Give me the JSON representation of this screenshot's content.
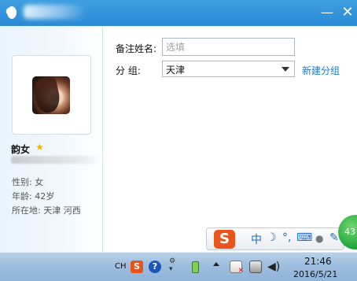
{
  "window": {
    "title_icon": "qq-penguin-icon",
    "minimize_label": "—",
    "close_label": "✕"
  },
  "profile": {
    "nickname": "韵女",
    "star_icon": "★",
    "gender": "性别: 女",
    "age": "年龄: 42岁",
    "location": "所在地: 天津  河西"
  },
  "form": {
    "remark_label": "备注姓名:",
    "remark_placeholder": "选填",
    "group_label": "分    组:",
    "group_value": "天津",
    "new_group_link": "新建分组"
  },
  "ime": {
    "logo": "S",
    "zh": "中",
    "moon": "☽",
    "punct": "°,",
    "keyboard": "⌨",
    "user": "●",
    "tools": "✎",
    "badge": "43"
  },
  "taskbar": {
    "lang": "CH",
    "sogou": "S",
    "help": "?",
    "time": "21:46",
    "date": "2016/5/21"
  }
}
